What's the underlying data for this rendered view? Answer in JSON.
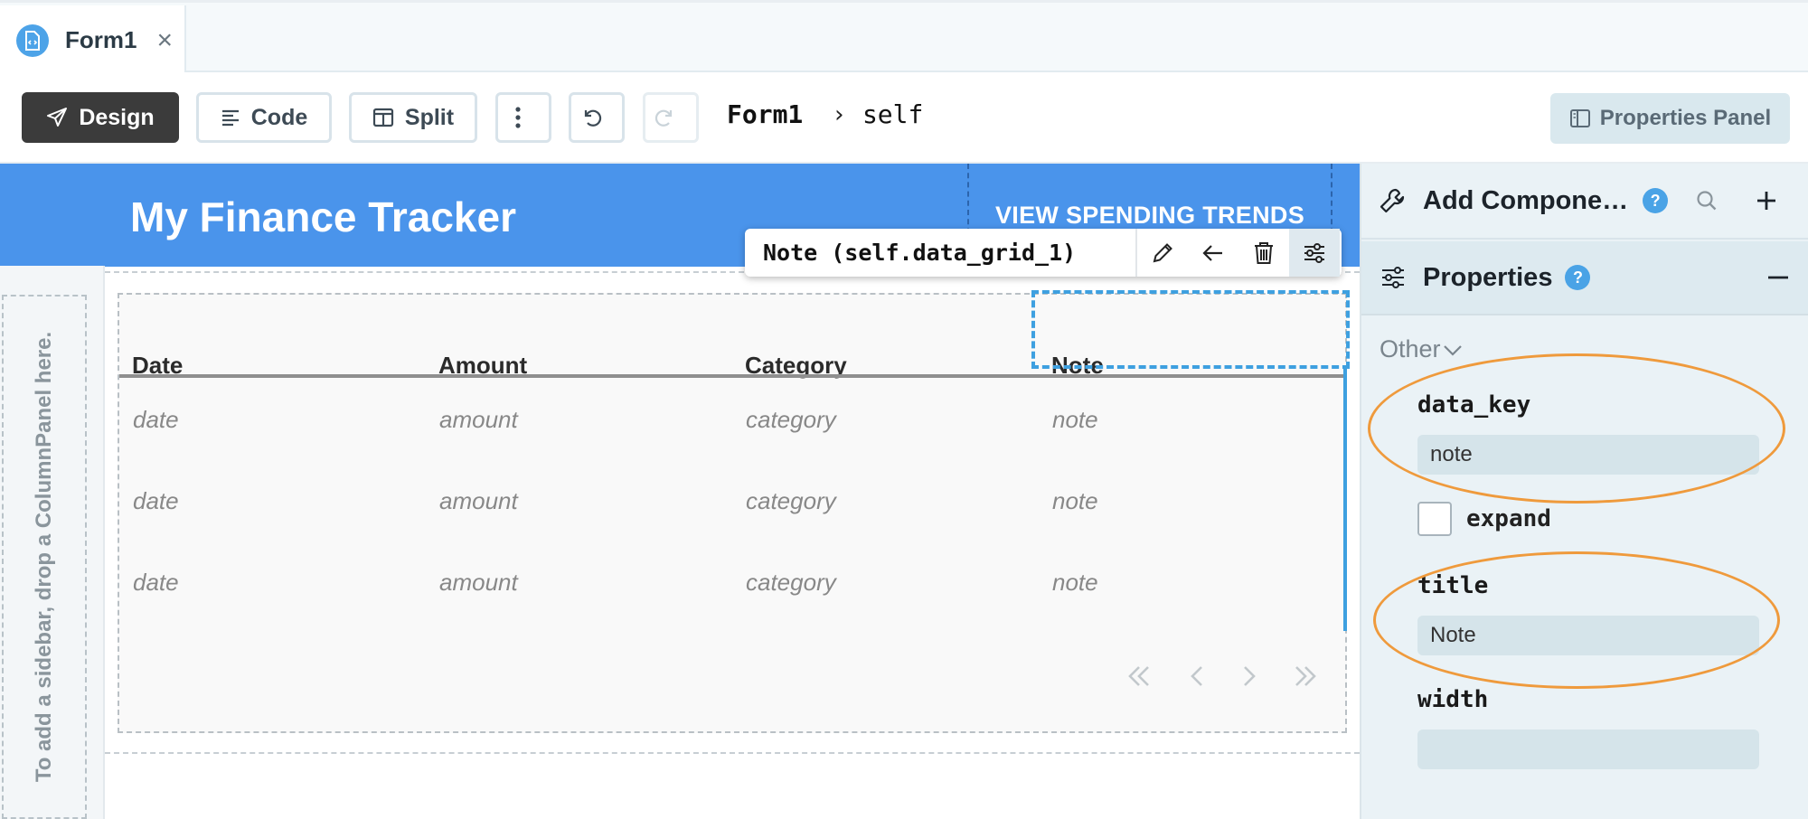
{
  "tab": {
    "label": "Form1",
    "close": "×"
  },
  "toolbar": {
    "design": "Design",
    "code": "Code",
    "split": "Split",
    "breadcrumb_form": "Form1",
    "breadcrumb_sep": "›",
    "breadcrumb_self": "self",
    "properties_panel": "Properties Panel"
  },
  "app": {
    "title": "My Finance Tracker",
    "nav_link": "VIEW SPENDING TRENDS",
    "sidebar_hint": "To add a sidebar, drop a ColumnPanel here."
  },
  "grid": {
    "columns": [
      "Date",
      "Amount",
      "Category",
      "Note"
    ],
    "rows": [
      [
        "date",
        "amount",
        "category",
        "note"
      ],
      [
        "date",
        "amount",
        "category",
        "note"
      ],
      [
        "date",
        "amount",
        "category",
        "note"
      ]
    ]
  },
  "component_toolbar": {
    "name": "Note (self.data_grid_1)"
  },
  "panel": {
    "add_components": "Add Compone…",
    "properties": "Properties",
    "help": "?",
    "group": "Other",
    "data_key_label": "data_key",
    "data_key_value": "note",
    "expand_label": "expand",
    "title_label": "title",
    "title_value": "Note",
    "width_label": "width",
    "width_value": ""
  },
  "colors": {
    "accent": "#4a94eb",
    "highlight": "#ef9a3c",
    "selection": "#3ea0e0"
  }
}
